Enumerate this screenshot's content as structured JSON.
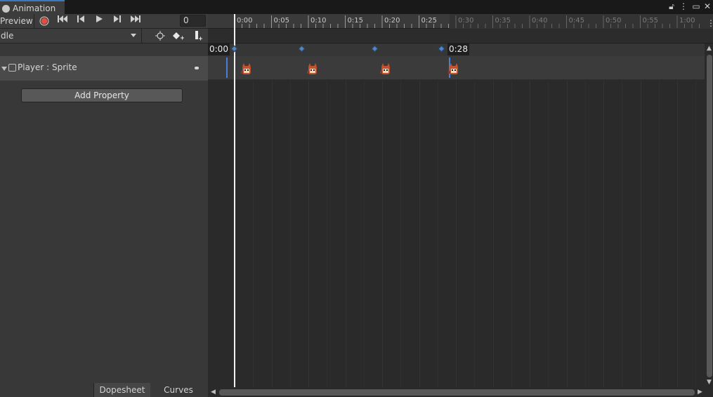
{
  "window": {
    "tab_title": "Animation",
    "icons": [
      "lock-icon",
      "more-vertical-icon",
      "maximize-icon",
      "close-icon"
    ]
  },
  "toolbar": {
    "preview_label": "Preview",
    "record_icon": "record-icon",
    "first_key_icon": "first-keyframe-icon",
    "prev_key_icon": "previous-keyframe-icon",
    "play_icon": "play-icon",
    "next_key_icon": "next-keyframe-icon",
    "last_key_icon": "last-keyframe-icon",
    "frame_value": "0"
  },
  "clip": {
    "selected": "dle",
    "add_keyframe_icon": "add-keyframe-icon",
    "add_event_icon": "add-event-icon",
    "snap_icon": "snap-icon"
  },
  "properties": [
    {
      "label": "Player : Sprite"
    }
  ],
  "add_property_label": "Add Property",
  "bottom_tabs": {
    "dopesheet": "Dopesheet",
    "curves": "Curves"
  },
  "timeline": {
    "ruler_labels": [
      "0:00",
      "0:05",
      "0:10",
      "0:15",
      "0:20",
      "0:25",
      "0:30",
      "0:35",
      "0:40",
      "0:45",
      "0:50",
      "0:55",
      "1:00"
    ],
    "start_badge": "0:00",
    "end_badge": "0:28",
    "keyframe_times": [
      "0:00",
      "0:10",
      "0:20",
      "0:28"
    ]
  },
  "colors": {
    "accent": "#3a79bb",
    "keyframe": "#4f86c6",
    "record": "#e24d3f"
  }
}
